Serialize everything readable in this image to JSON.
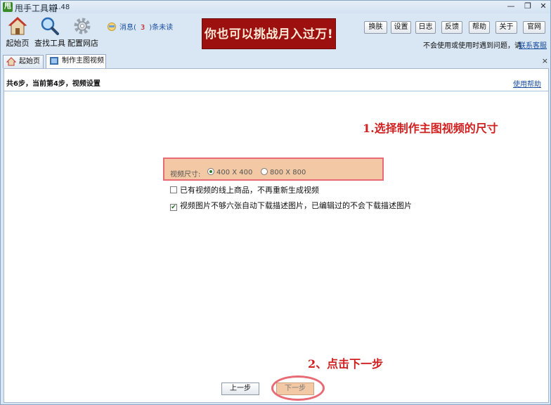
{
  "app": {
    "logo_char": "甩",
    "title": "甩手工具箱",
    "version": "1.48"
  },
  "window_controls": {
    "minimize": "—",
    "restore": "❐",
    "close": "✕"
  },
  "toolbar": {
    "home_label": "起始页",
    "find_tools_label": "查找工具",
    "config_shop_label": "配置网店",
    "messages_prefix": "消息(",
    "messages_count": "3",
    "messages_suffix": ")条未读",
    "banner_text": "你也可以挑战月入过万!"
  },
  "top_buttons": [
    "换肤",
    "设置",
    "日志",
    "反馈",
    "帮助",
    "关于",
    "官网"
  ],
  "support": {
    "issue_text": "不会使用或使用时遇到问题，请",
    "contact_link": "联系客服"
  },
  "tabs": [
    {
      "label": "起始页",
      "active": false
    },
    {
      "label": "制作主图视频",
      "active": true
    }
  ],
  "tab_strip_close": "×",
  "wizard": {
    "steps_text": "共6步，当前第4步，视频设置",
    "help_link": "使用帮助",
    "video_size_label": "视频尺寸:",
    "size_options": [
      {
        "label": "400 X 400",
        "selected": true
      },
      {
        "label": "800 X 800",
        "selected": false
      }
    ],
    "checkboxes": [
      {
        "label": "已有视频的线上商品，不再重新生成视频",
        "checked": false
      },
      {
        "label": "视频图片不够六张自动下载描述图片，已编辑过的不会下载描述图片",
        "checked": true
      }
    ],
    "prev_label": "上一步",
    "next_label": "下一步"
  },
  "annotations": {
    "step1": "1.选择制作主图视频的尺寸",
    "step2": "2、点击下一步"
  },
  "colors": {
    "banner_bg": "#9c1010",
    "highlight_fill": "#f2c9a4",
    "highlight_border": "#e86a74",
    "annotation_red": "#d02020",
    "link_blue": "#1a4fa0"
  }
}
